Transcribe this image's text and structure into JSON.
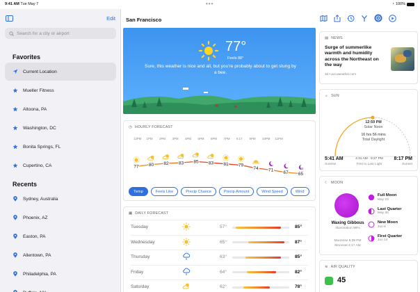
{
  "status": {
    "time": "9:41 AM",
    "date": "Tue May 7",
    "battery": "100%"
  },
  "sidebar": {
    "edit_label": "Edit",
    "search_placeholder": "Search for a city or airport",
    "favorites_title": "Favorites",
    "favorites": [
      {
        "label": "Current Location",
        "icon": "location-arrow-icon"
      },
      {
        "label": "Mueller Fitness",
        "icon": "star-icon"
      },
      {
        "label": "Altoona, PA",
        "icon": "star-icon"
      },
      {
        "label": "Washington, DC",
        "icon": "star-icon"
      },
      {
        "label": "Bonita Springs, FL",
        "icon": "star-icon"
      },
      {
        "label": "Cupertino, CA",
        "icon": "star-icon"
      }
    ],
    "recents_title": "Recents",
    "recents": [
      {
        "label": "Sydney, Australia",
        "icon": "pin-icon"
      },
      {
        "label": "Phoenix, AZ",
        "icon": "pin-icon"
      },
      {
        "label": "Easton, PA",
        "icon": "pin-icon"
      },
      {
        "label": "Allentown, PA",
        "icon": "pin-icon"
      },
      {
        "label": "Philadelphia, PA",
        "icon": "pin-icon"
      },
      {
        "label": "Buffalo, NY",
        "icon": "pin-icon"
      }
    ]
  },
  "header": {
    "city": "San Francisco"
  },
  "hero": {
    "temperature": "77°",
    "feels_like": "Feels 88°",
    "message": "Sure, this weather is nice and all, but you're probably about to get stung by a bee."
  },
  "hourly": {
    "title": "HOURLY FORECAST",
    "hours": [
      "12PM",
      "1PM",
      "2PM",
      "3PM",
      "4PM",
      "5PM",
      "6PM",
      "7PM",
      "8:17",
      "9PM",
      "10PM",
      "11PM"
    ],
    "icons": [
      "sun",
      "sun-cloud",
      "sun-cloud",
      "sun-cloud",
      "sun-cloud",
      "sun-cloud",
      "sun",
      "sun",
      "sunset",
      "moon",
      "moon",
      "moon-cloud"
    ],
    "temps": [
      77,
      80,
      82,
      83,
      85,
      83,
      81,
      79,
      74,
      71,
      67,
      65
    ],
    "pills": [
      "Temp",
      "Feels Like",
      "Precip Chance",
      "Precip Amount",
      "Wind Speed",
      "Wind"
    ],
    "active_pill": "Temp"
  },
  "daily": {
    "title": "DAILY FORECAST",
    "days": [
      {
        "day": "Tuesday",
        "icon": "sun",
        "low": "57°",
        "high": "85°"
      },
      {
        "day": "Wednesday",
        "icon": "sun",
        "low": "65°",
        "high": "87°"
      },
      {
        "day": "Thursday",
        "icon": "rain",
        "low": "63°",
        "high": "85°"
      },
      {
        "day": "Friday",
        "icon": "rain",
        "low": "64°",
        "high": "82°"
      },
      {
        "day": "Saturday",
        "icon": "sun-cloud",
        "low": "62°",
        "high": "78°"
      }
    ],
    "range": [
      55,
      90
    ]
  },
  "news": {
    "label": "NEWS",
    "headline": "Surge of summerlike warmth and humidity across the Northeast on the way",
    "source": "3d • accuweather.com"
  },
  "sun": {
    "label": "SUN",
    "solar_noon_time": "12:59 PM",
    "solar_noon_label": "Solar Noon",
    "daylight_value": "16 hrs 56 mins",
    "daylight_label": "Total Daylight",
    "sunrise_time": "5:41 AM",
    "sunrise_label": "Sunrise",
    "first_last_range": "4:31 AM - 9:27 PM",
    "first_last_label": "First to Last Light",
    "sunset_time": "8:17 PM",
    "sunset_label": "Sunset"
  },
  "moon": {
    "label": "MOON",
    "phase": "Waxing Gibbous",
    "illumination": "Illumination 98%",
    "moonrise": "Moonrise 6:39 PM",
    "moonset": "Moonset 4:17 AM",
    "phases": [
      {
        "name": "Full Moon",
        "date": "May 23"
      },
      {
        "name": "Last Quarter",
        "date": "May 30"
      },
      {
        "name": "New Moon",
        "date": "Jun 6"
      },
      {
        "name": "First Quarter",
        "date": "Jun 14"
      }
    ]
  },
  "air": {
    "label": "AIR QUALITY",
    "value": "45"
  },
  "colors": {
    "accent": "#2f6fde",
    "moon": "#c020e0",
    "sun_arc": "#f5a623",
    "aqi": "#3cc24a"
  }
}
